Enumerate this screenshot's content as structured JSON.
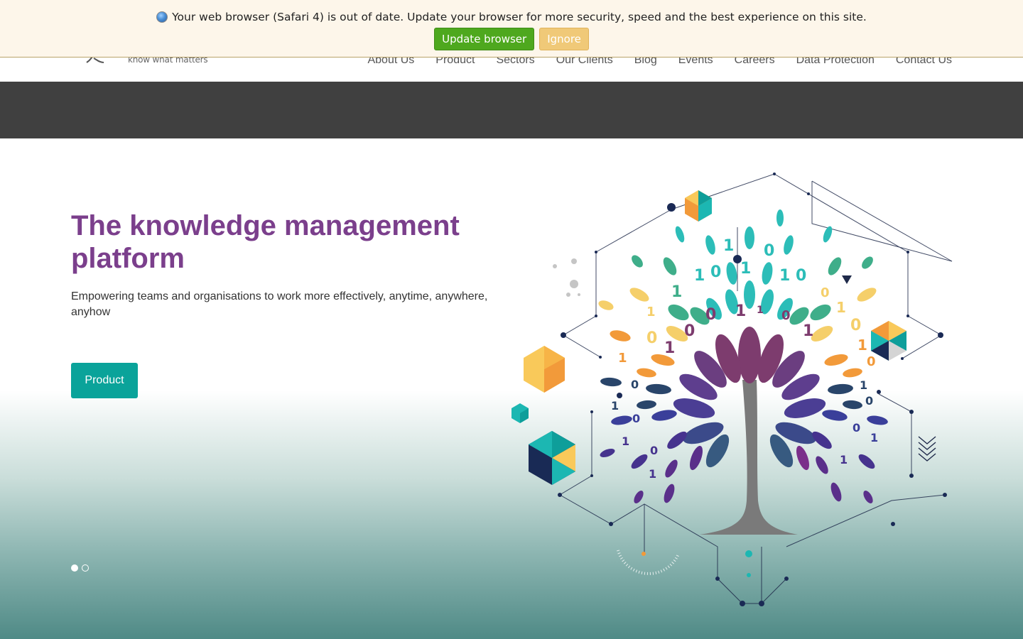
{
  "browser_bar": {
    "message": "Your web browser (Safari 4) is out of date. Update your browser for more security, speed and the best experience on this site.",
    "update_label": "Update browser",
    "ignore_label": "Ignore"
  },
  "header": {
    "logo_tagline": "know what matters",
    "nav": [
      {
        "label": "About Us"
      },
      {
        "label": "Product"
      },
      {
        "label": "Sectors"
      },
      {
        "label": "Our Clients"
      },
      {
        "label": "Blog"
      },
      {
        "label": "Events"
      },
      {
        "label": "Careers"
      },
      {
        "label": "Data Protection"
      },
      {
        "label": "Contact Us"
      }
    ]
  },
  "hero": {
    "title": "The knowledge management platform",
    "subtitle": "Empowering teams and organisations to work more effectively, anytime, anywhere, anyhow",
    "button_label": "Product",
    "slides_count": 2,
    "active_slide": 1
  },
  "colors": {
    "title": "#7b3f8c",
    "accent_teal": "#0aa39a",
    "update_green": "#4ea81e",
    "ignore_amber": "#f0c978",
    "dark_band": "#404040"
  }
}
